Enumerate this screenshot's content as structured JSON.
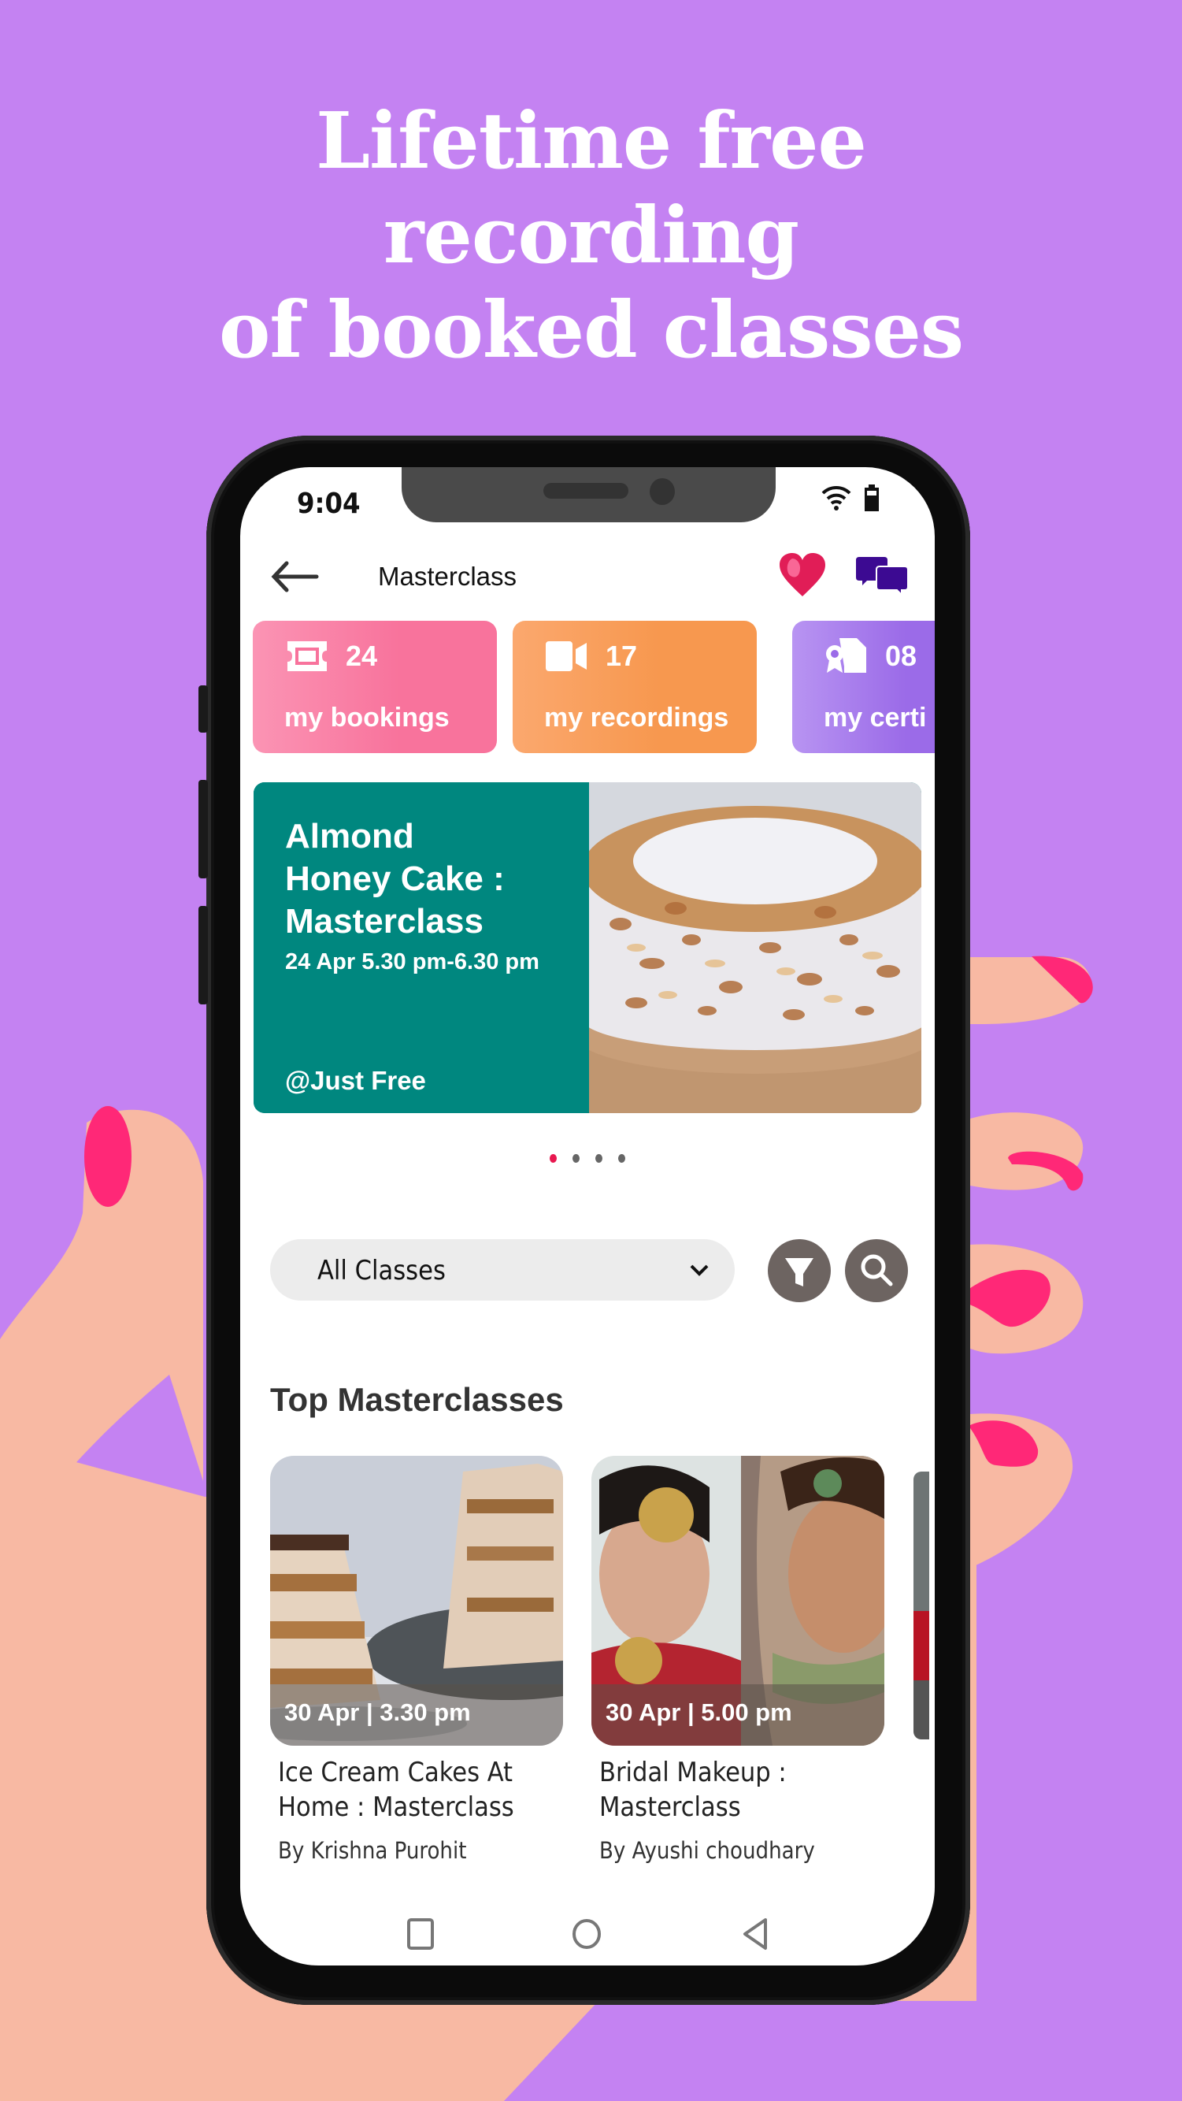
{
  "headline": {
    "lines": [
      "Lifetime free",
      "recording",
      "of booked classes"
    ]
  },
  "colors": {
    "background": "#c482f2",
    "skin": "#f8b9a3",
    "nail": "#ff2877",
    "teal": "#00877f",
    "bookings": "#f8739c",
    "recordings": "#f7984f",
    "certificates": "#9b6be8",
    "chat": "#3c0a92",
    "active_dot": "#e8174f"
  },
  "status_bar": {
    "time": "9:04",
    "icons": [
      "wifi-icon",
      "battery-icon"
    ]
  },
  "app_bar": {
    "title": "Masterclass",
    "back_icon": "arrow-left-icon",
    "actions": [
      "heart-icon",
      "chat-icon"
    ]
  },
  "stats": [
    {
      "icon": "ticket-icon",
      "count": "24",
      "label": "my bookings"
    },
    {
      "icon": "video-camera-icon",
      "count": "17",
      "label": "my recordings"
    },
    {
      "icon": "certificate-icon",
      "count": "08",
      "label": "my certi"
    }
  ],
  "banner": {
    "title": "Almond Honey Cake : Masterclass",
    "title_lines": [
      "Almond",
      "Honey Cake :",
      "Masterclass"
    ],
    "date": "24 Apr 5.30 pm-6.30 pm",
    "price": "@Just Free",
    "image": "almond-cake-photo"
  },
  "carousel": {
    "total": 4,
    "active": 1
  },
  "filter": {
    "selected": "All Classes",
    "filter_icon": "filter-icon",
    "search_icon": "search-icon"
  },
  "top_masterclasses": {
    "title": "Top Masterclasses",
    "items": [
      {
        "date": "30 Apr | 3.30 pm",
        "title": "Ice Cream Cakes At Home : Masterclass",
        "title_lines": [
          "Ice Cream Cakes At",
          "Home : Masterclass"
        ],
        "author": "By Krishna Purohit",
        "image": "ice-cream-cake-photo"
      },
      {
        "date": "30 Apr | 5.00 pm",
        "title": "Bridal Makeup : Masterclass",
        "title_lines": [
          "Bridal Makeup :",
          "Masterclass"
        ],
        "author": "By Ayushi choudhary",
        "image": "bridal-makeup-photo"
      }
    ]
  },
  "nav_bar": [
    "recents-icon",
    "home-icon",
    "back-icon"
  ]
}
